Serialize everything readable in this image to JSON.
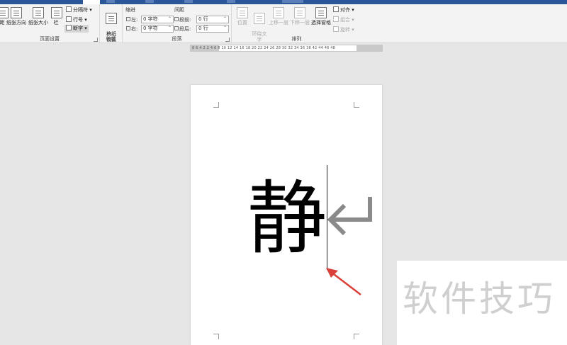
{
  "ribbon": {
    "page_setup": {
      "label": "页面设置",
      "margins_label": "距",
      "orientation_label": "纸张方向",
      "size_label": "纸张大小",
      "columns_label": "栏",
      "breaks_label": "分隔符",
      "line_numbers_label": "行号",
      "hyphenation_label": "断字"
    },
    "manuscript": {
      "label": "稿纸",
      "settings_label": "稿纸\n设置"
    },
    "paragraph": {
      "label": "段落",
      "indent_header": "缩进",
      "spacing_header": "间距",
      "indent_left_label": "左:",
      "indent_left_value": "0 字符",
      "indent_right_label": "右:",
      "indent_right_value": "0 字符",
      "spacing_before_label": "段前:",
      "spacing_before_value": "0 行",
      "spacing_after_label": "段后:",
      "spacing_after_value": "0 行"
    },
    "arrange": {
      "label": "排列",
      "position_label": "位置",
      "wrap_text_label": "环绕文\n字",
      "bring_forward_label": "上移一层",
      "send_backward_label": "下移一层",
      "selection_pane_label": "选择窗格",
      "align_label": "对齐",
      "group_label": "组合",
      "rotate_label": "旋转"
    }
  },
  "ruler": {
    "ticks": "8  6  4  2     2  4  6  8  10  12  14  16  18  20  22  24  26  28  30  32  34  36  38     42  44  46  48"
  },
  "document": {
    "text": "静"
  },
  "watermark": {
    "text": "软件技巧"
  },
  "colors": {
    "title_bar": "#2b579a",
    "ribbon_bg": "#f3f3f3",
    "workspace_bg": "#e6e6e6",
    "arrow_red": "#d9413a",
    "return_mark": "#8a8a8a"
  }
}
